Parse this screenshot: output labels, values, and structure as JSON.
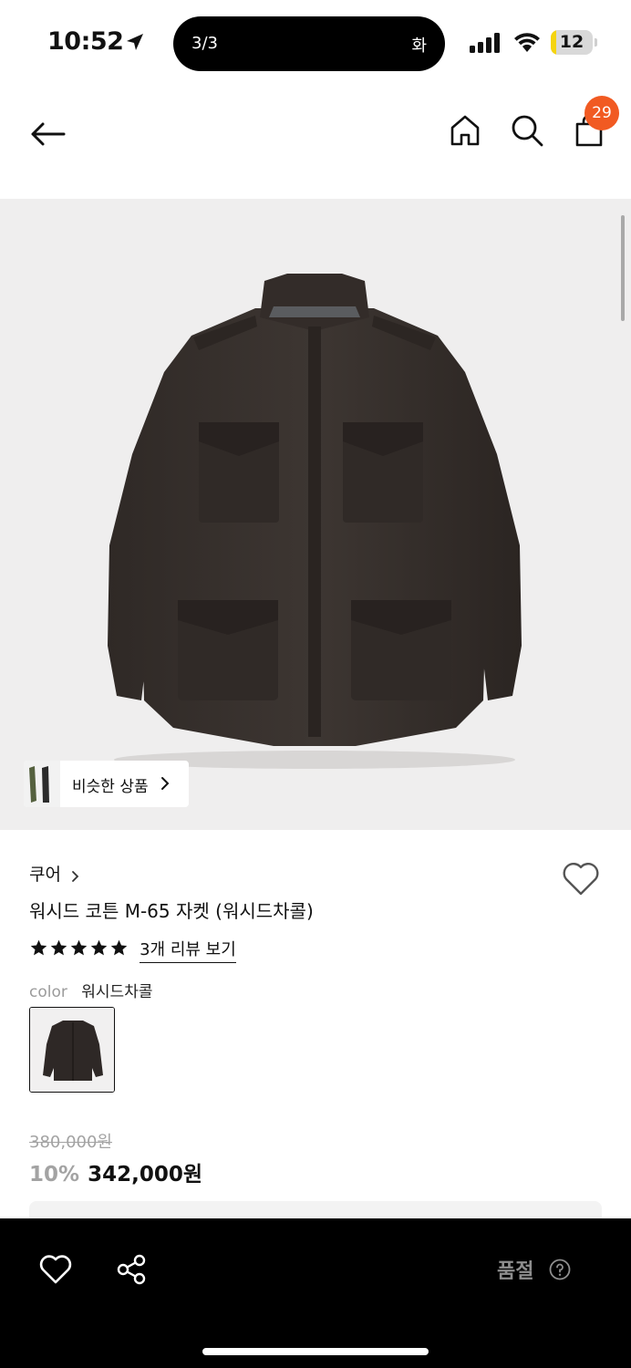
{
  "status_bar": {
    "time": "10:52",
    "island_left": "3/3",
    "island_right": "화",
    "battery": "12",
    "battery_level": 0.12
  },
  "header": {
    "cart_count": "29"
  },
  "product_image": {
    "similar_label": "비슷한 상품"
  },
  "product": {
    "brand": "쿠어",
    "title": "워시드 코튼 M-65 자켓 (워시드차콜)",
    "rating": 5,
    "review_link": "3개 리뷰 보기",
    "color_label": "color",
    "color_value": "워시드차콜",
    "price_original": "380,000원",
    "discount": "10%",
    "price_final": "342,000원"
  },
  "bottom_bar": {
    "soldout_label": "품절"
  },
  "colors": {
    "badge": "#f15a22",
    "battery_fill": "#f5d40f",
    "jacket": "#3b3431"
  }
}
